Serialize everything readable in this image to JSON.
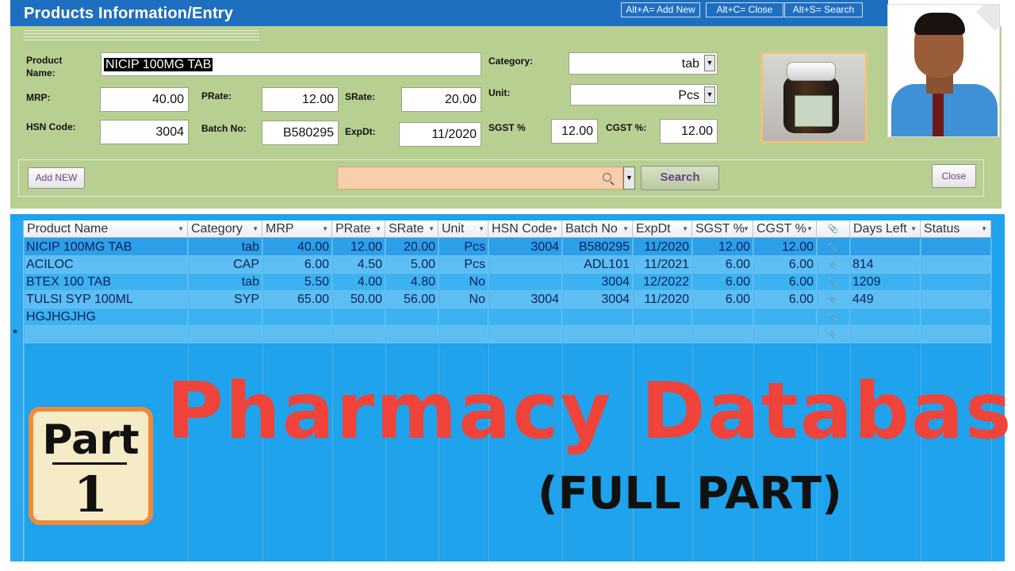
{
  "window": {
    "title": "Products Information/Entry",
    "hotkeys": [
      "Alt+A= Add New",
      "Alt+C= Close",
      "Alt+S= Search"
    ]
  },
  "form": {
    "labels": {
      "product_name": "Product Name:",
      "mrp": "MRP:",
      "hsn": "HSN Code:",
      "prate": "PRate:",
      "batch": "Batch No:",
      "srate": "SRate:",
      "expdt": "ExpDt:",
      "category": "Category:",
      "unit": "Unit:",
      "sgst": "SGST %",
      "cgst": "CGST %:"
    },
    "values": {
      "product_name": "NICIP 100MG TAB",
      "mrp": "40.00",
      "hsn": "3004",
      "prate": "12.00",
      "batch": "B580295",
      "srate": "20.00",
      "expdt": "11/2020",
      "category": "tab",
      "unit": "Pcs",
      "sgst": "12.00",
      "cgst": "12.00"
    }
  },
  "actions": {
    "add_new": "Add NEW",
    "search": "Search",
    "close": "Close",
    "search_value": ""
  },
  "table": {
    "columns": [
      "Product Name",
      "Category",
      "MRP",
      "PRate",
      "SRate",
      "Unit",
      "HSN Code",
      "Batch No",
      "ExpDt",
      "SGST %",
      "CGST %",
      "",
      "Days Left",
      "Status"
    ],
    "rows": [
      [
        "NICIP 100MG TAB",
        "tab",
        "40.00",
        "12.00",
        "20.00",
        "Pcs",
        "3004",
        "B580295",
        "11/2020",
        "12.00",
        "12.00",
        "(0)",
        "",
        ""
      ],
      [
        "ACILOC",
        "CAP",
        "6.00",
        "4.50",
        "5.00",
        "Pcs",
        "",
        "ADL101",
        "11/2021",
        "6.00",
        "6.00",
        "(0)",
        "814",
        ""
      ],
      [
        "BTEX 100 TAB",
        "tab",
        "5.50",
        "4.00",
        "4.80",
        "No",
        "",
        "3004",
        "12/2022",
        "6.00",
        "6.00",
        "(0)",
        "1209",
        ""
      ],
      [
        "TULSI SYP 100ML",
        "SYP",
        "65.00",
        "50.00",
        "56.00",
        "No",
        "3004",
        "3004",
        "11/2020",
        "6.00",
        "6.00",
        "(0)",
        "449",
        ""
      ],
      [
        "HGJHGJHG",
        "",
        "",
        "",
        "",
        "",
        "",
        "",
        "",
        "",
        "",
        "(0)",
        "",
        ""
      ],
      [
        "",
        "",
        "",
        "",
        "",
        "",
        "",
        "",
        "",
        "",
        "",
        "(0)",
        "",
        ""
      ]
    ],
    "new_row_marker": "*"
  },
  "overlay": {
    "title": "Pharmacy Database",
    "subtitle": "(FULL PART)",
    "part_word": "Part",
    "part_number": "1"
  },
  "colors": {
    "title_bar": "#1f6fc0",
    "form_bg": "#b8cf92",
    "sheet_bg": "#1ea3ec",
    "big_title": "#f0433a",
    "part_border": "#f08a3a"
  },
  "icons": [
    "search-icon",
    "dropdown-arrow-icon",
    "attachment-icon",
    "sort-arrow-icon"
  ]
}
